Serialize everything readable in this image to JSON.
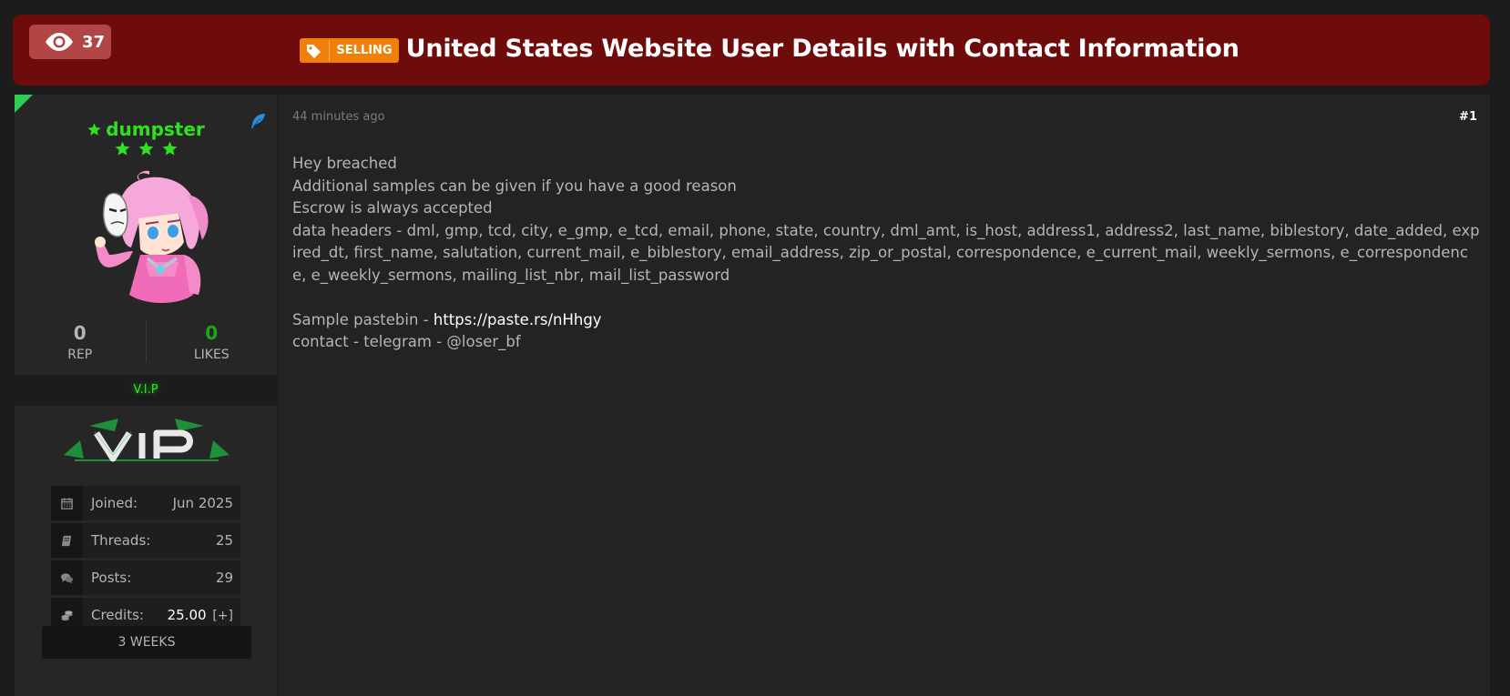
{
  "header": {
    "views_count": "37",
    "prefix_label": "SELLING",
    "title": "United States Website User Details with Contact Information"
  },
  "author": {
    "username": "dumpster",
    "rep_value": "0",
    "rep_label": "REP",
    "likes_value": "0",
    "likes_label": "LIKES",
    "group": "V.I.P",
    "info": [
      {
        "icon": "calendar-icon",
        "label": "Joined:",
        "value": "Jun 2025"
      },
      {
        "icon": "book-icon",
        "label": "Threads:",
        "value": "25"
      },
      {
        "icon": "comments-icon",
        "label": "Posts:",
        "value": "29"
      },
      {
        "icon": "coins-icon",
        "label": "Credits:",
        "value": "25.00",
        "extra": "[+]"
      }
    ],
    "tenure": "3 WEEKS"
  },
  "post": {
    "time": "44 minutes ago",
    "number": "#1",
    "lines": [
      "Hey breached",
      "Additional samples can be given if you have a good reason",
      "Escrow is always accepted",
      "data headers - dml, gmp, tcd, city, e_gmp, e_tcd, email, phone, state, country, dml_amt, is_host, address1, address2, last_name, biblestory, date_added, expired_dt, first_name, salutation, current_mail, e_biblestory, email_address, zip_or_postal, correspondence, e_current_mail, weekly_sermons, e_correspondence, e_weekly_sermons, mailing_list_nbr, mail_list_password"
    ],
    "pastebin_prefix": "Sample pastebin - ",
    "pastebin_link": "https://paste.rs/nHhgy",
    "contact_line": "contact - telegram - @loser_bf"
  },
  "colors": {
    "header_bg": "#6e0c0c",
    "badge_bg": "#b24545",
    "prefix_bg": "#f0800a",
    "username_green": "#2ee21d",
    "likes_green": "#1ea51e"
  }
}
